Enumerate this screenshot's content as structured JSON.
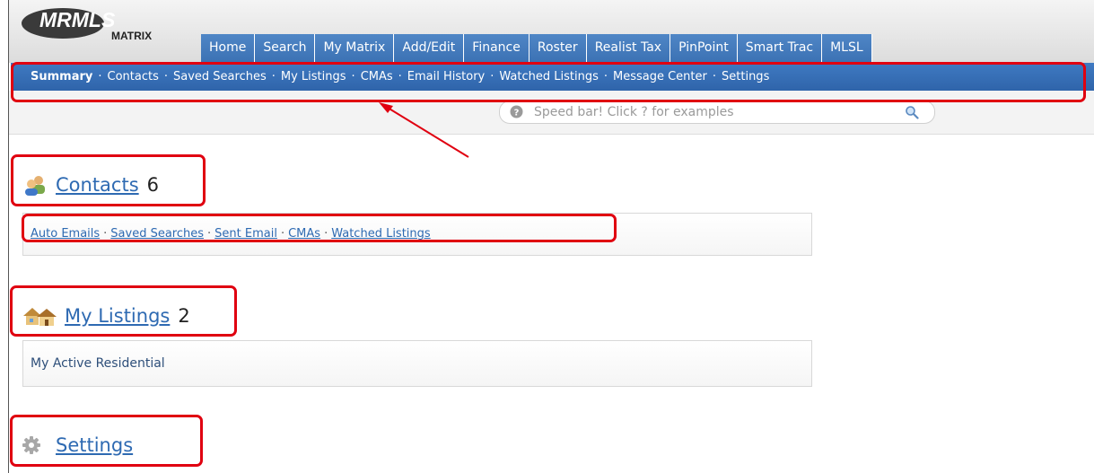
{
  "logo": {
    "top": "MRMLS",
    "bottom": "MATRIX"
  },
  "main_tabs": [
    "Home",
    "Search",
    "My Matrix",
    "Add/Edit",
    "Finance",
    "Roster",
    "Realist Tax",
    "PinPoint",
    "Smart Trac",
    "MLSL"
  ],
  "sub_nav": [
    "Summary",
    "Contacts",
    "Saved Searches",
    "My Listings",
    "CMAs",
    "Email History",
    "Watched Listings",
    "Message Center",
    "Settings"
  ],
  "sub_nav_separator": "·",
  "speed_bar": {
    "placeholder": "Speed bar! Click ? for examples"
  },
  "contacts": {
    "title": "Contacts",
    "count": "6",
    "links": [
      "Auto Emails",
      "Saved Searches",
      "Sent Email",
      "CMAs",
      "Watched Listings"
    ],
    "separator": "·"
  },
  "listings": {
    "title": "My Listings",
    "count": "2",
    "items": [
      "My Active Residential"
    ]
  },
  "settings": {
    "title": "Settings"
  },
  "colors": {
    "nav_blue": "#3a70b8",
    "link_blue": "#2e6ab2",
    "highlight_red": "#e00010"
  }
}
